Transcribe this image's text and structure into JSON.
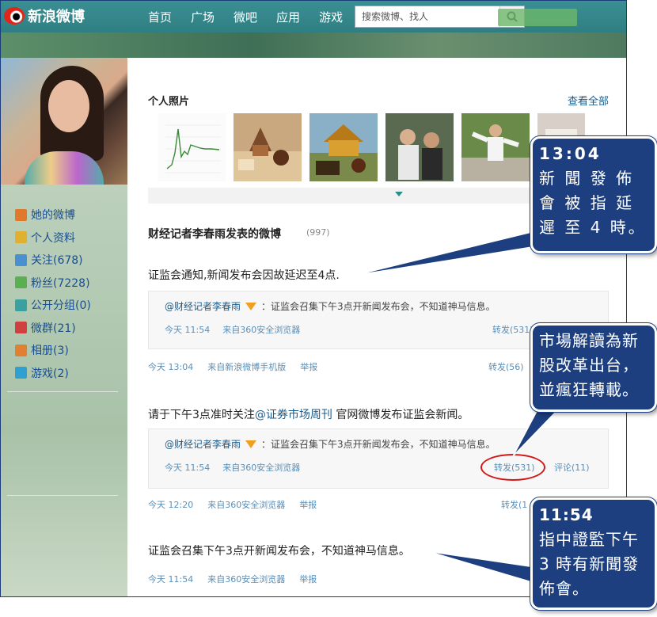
{
  "header": {
    "logo_text": "新浪微博",
    "nav": [
      "首页",
      "广场",
      "微吧",
      "应用",
      "游戏"
    ],
    "search_placeholder": "搜索微博、找人"
  },
  "sidebar": {
    "items": [
      {
        "label": "她的微博",
        "icon": "home-icon",
        "color": "#e07a2a"
      },
      {
        "label": "个人资料",
        "icon": "profile-icon",
        "color": "#e0b030"
      },
      {
        "label": "关注(678)",
        "icon": "follow-icon",
        "color": "#4a90d0"
      },
      {
        "label": "粉丝(7228)",
        "icon": "fans-icon",
        "color": "#5ab050"
      },
      {
        "label": "公开分组(0)",
        "icon": "group-icon",
        "color": "#3aa0a0"
      },
      {
        "label": "微群(21)",
        "icon": "weiqun-icon",
        "color": "#d04040"
      },
      {
        "label": "相册(3)",
        "icon": "album-icon",
        "color": "#e08030"
      },
      {
        "label": "游戏(2)",
        "icon": "game-icon",
        "color": "#30a0d0"
      }
    ]
  },
  "photos": {
    "title": "个人照片",
    "see_all": "查看全部"
  },
  "weibo": {
    "title": "财经记者李春雨发表的微博",
    "count": "(997)",
    "posts": [
      {
        "text": "证监会通知,新闻发布会因故延迟至4点.",
        "quote": {
          "user": "@财经记者李春雨",
          "text": "：证监会召集下午3点开新闻发布会，不知道神马信息。",
          "time": "今天 11:54",
          "source": "来自360安全浏览器",
          "repost": "转发(531)"
        },
        "time": "今天 13:04",
        "source": "来自新浪微博手机版",
        "report": "举报",
        "repost": "转发(56)"
      },
      {
        "text_pre": "请于下午3点准时关注",
        "text_link": "@证券市场周刊",
        "text_post": " 官网微博发布证监会新闻。",
        "quote": {
          "user": "@财经记者李春雨",
          "text": "：证监会召集下午3点开新闻发布会，不知道神马信息。",
          "time": "今天 11:54",
          "source": "来自360安全浏览器",
          "repost": "转发(531)",
          "comment": "评论(11)"
        },
        "time": "今天 12:20",
        "source": "来自360安全浏览器",
        "report": "举报",
        "repost": "转发(1"
      },
      {
        "text": "证监会召集下午3点开新闻发布会，不知道神马信息。",
        "time": "今天 11:54",
        "source": "来自360安全浏览器",
        "report": "举报"
      }
    ]
  },
  "callouts": [
    {
      "time": "13:04",
      "text": "新 聞 發 佈 會 被 指 延 遲 至 4 時。"
    },
    {
      "text": "市場解讀為新股改革出台，並瘋狂轉載。"
    },
    {
      "time": "11:54",
      "text": "指中證監下午 3 時有新聞發佈會。"
    }
  ]
}
